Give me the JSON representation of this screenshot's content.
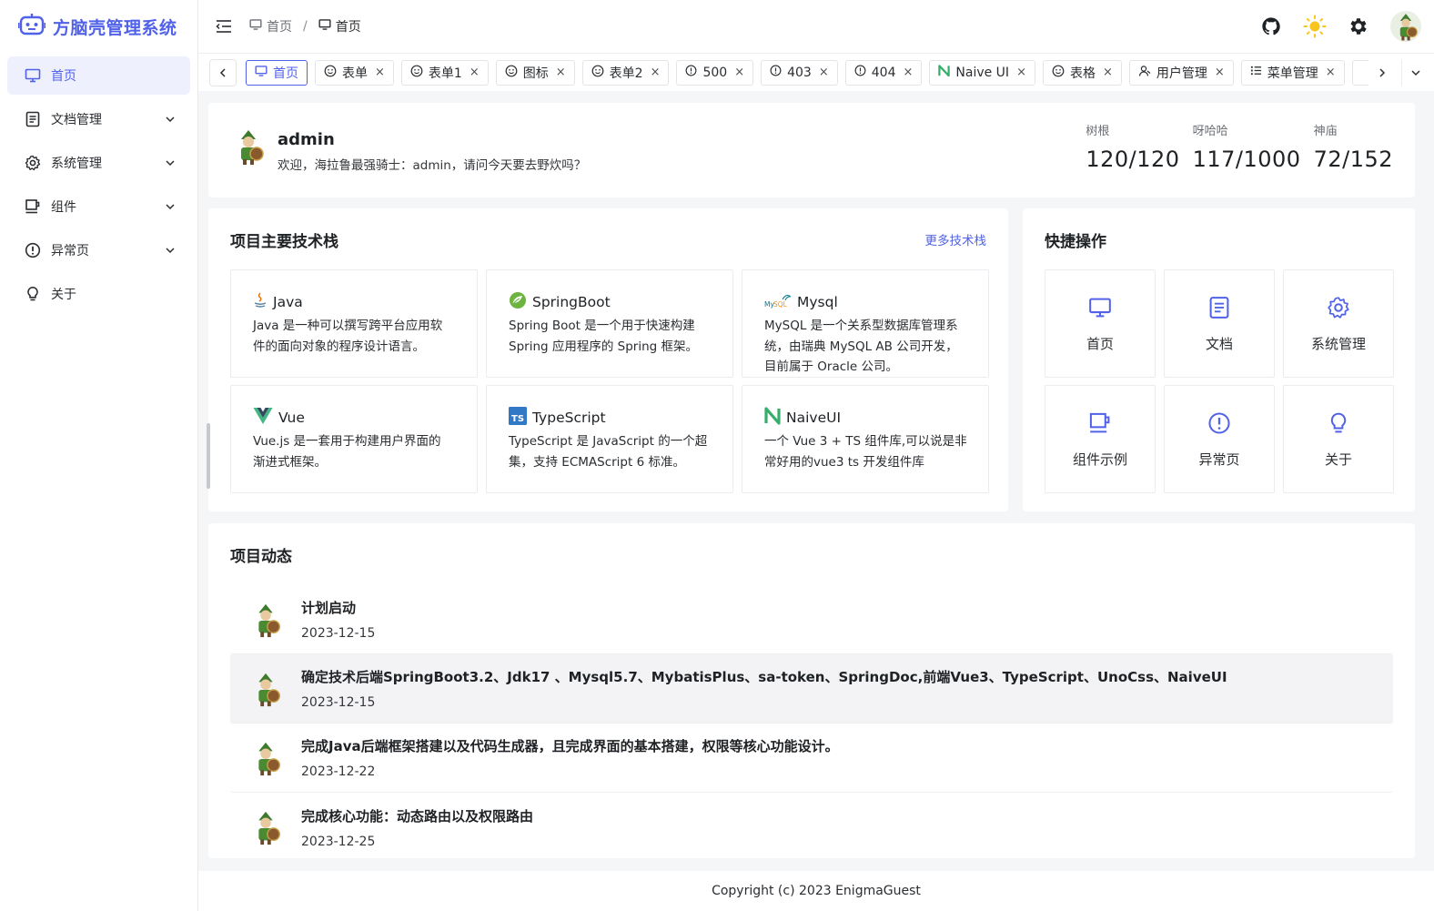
{
  "app": {
    "title": "方脑壳管理系统"
  },
  "sidebar": {
    "items": [
      {
        "label": "首页",
        "icon": "monitor-icon",
        "active": true
      },
      {
        "label": "文档管理",
        "icon": "document-icon"
      },
      {
        "label": "系统管理",
        "icon": "gear-icon"
      },
      {
        "label": "组件",
        "icon": "cup-icon"
      },
      {
        "label": "异常页",
        "icon": "alert-circle-icon"
      },
      {
        "label": "关于",
        "icon": "bulb-icon"
      }
    ]
  },
  "header": {
    "breadcrumb": [
      {
        "label": "首页"
      },
      {
        "label": "首页"
      }
    ],
    "separator": "/"
  },
  "tabs": [
    {
      "label": "首页",
      "icon": "monitor-icon",
      "active": true
    },
    {
      "label": "表单",
      "icon": "smile-icon"
    },
    {
      "label": "表单1",
      "icon": "smile-icon"
    },
    {
      "label": "图标",
      "icon": "smile-icon"
    },
    {
      "label": "表单2",
      "icon": "smile-icon"
    },
    {
      "label": "500",
      "icon": "alert-circle-icon"
    },
    {
      "label": "403",
      "icon": "alert-circle-icon"
    },
    {
      "label": "404",
      "icon": "alert-circle-icon"
    },
    {
      "label": "Naive UI",
      "icon": "naive-logo-icon"
    },
    {
      "label": "表格",
      "icon": "smile-icon"
    },
    {
      "label": "用户管理",
      "icon": "users-icon"
    },
    {
      "label": "菜单管理",
      "icon": "list-icon"
    }
  ],
  "tab_close": "×",
  "user": {
    "name": "admin",
    "welcome": "欢迎，海拉鲁最强骑士：admin，请问今天要去野炊吗？",
    "stats": [
      {
        "label": "树根",
        "value": "120/120"
      },
      {
        "label": "呀哈哈",
        "value": "117/1000"
      },
      {
        "label": "神庙",
        "value": "72/152"
      }
    ]
  },
  "tech": {
    "title": "项目主要技术栈",
    "more": "更多技术栈",
    "items": [
      {
        "name": "Java",
        "icon": "java-icon",
        "desc": [
          "Java 是一种可以撰写跨平台应用软",
          "件的面向对象的程序设计语言。"
        ]
      },
      {
        "name": "SpringBoot",
        "icon": "spring-icon",
        "desc": [
          "Spring Boot 是一个用于快速构建",
          "Spring 应用程序的 Spring 框架。"
        ]
      },
      {
        "name": "Mysql",
        "icon": "mysql-icon",
        "desc": [
          "MySQL 是一个关系型数据库管理系",
          "统，由瑞典 MySQL AB 公司开发，",
          "目前属于 Oracle 公司。"
        ]
      },
      {
        "name": "Vue",
        "icon": "vue-icon",
        "desc": [
          "Vue.js 是一套用于构建用户界面的",
          "渐进式框架。"
        ]
      },
      {
        "name": "TypeScript",
        "icon": "typescript-icon",
        "desc": [
          "TypeScript 是 JavaScript 的一个超",
          "集，支持 ECMAScript 6 标准。"
        ]
      },
      {
        "name": "NaiveUI",
        "icon": "naive-logo-icon",
        "desc": [
          "一个 Vue 3 + TS 组件库,可以说是非",
          "常好用的vue3 ts 开发组件库"
        ]
      }
    ]
  },
  "quick": {
    "title": "快捷操作",
    "items": [
      {
        "label": "首页",
        "icon": "monitor-icon"
      },
      {
        "label": "文档",
        "icon": "document-icon"
      },
      {
        "label": "系统管理",
        "icon": "gear-icon"
      },
      {
        "label": "组件示例",
        "icon": "cup-icon"
      },
      {
        "label": "异常页",
        "icon": "alert-circle-icon"
      },
      {
        "label": "关于",
        "icon": "bulb-icon"
      }
    ]
  },
  "dynamics": {
    "title": "项目动态",
    "items": [
      {
        "title": "计划启动",
        "date": "2023-12-15"
      },
      {
        "title": "确定技术后端SpringBoot3.2、Jdk17 、Mysql5.7、MybatisPlus、sa-token、SpringDoc,前端Vue3、TypeScript、UnoCss、NaiveUI",
        "date": "2023-12-15",
        "highlight": true
      },
      {
        "title": "完成Java后端框架搭建以及代码生成器，且完成界面的基本搭建，权限等核心功能设计。",
        "date": "2023-12-22"
      },
      {
        "title": "完成核心功能：动态路由以及权限路由",
        "date": "2023-12-25"
      }
    ]
  },
  "footer": {
    "copyright": "Copyright (c) 2023 EnigmaGuest"
  },
  "colors": {
    "primary": "#5162e8",
    "background": "#f5f6f8"
  }
}
